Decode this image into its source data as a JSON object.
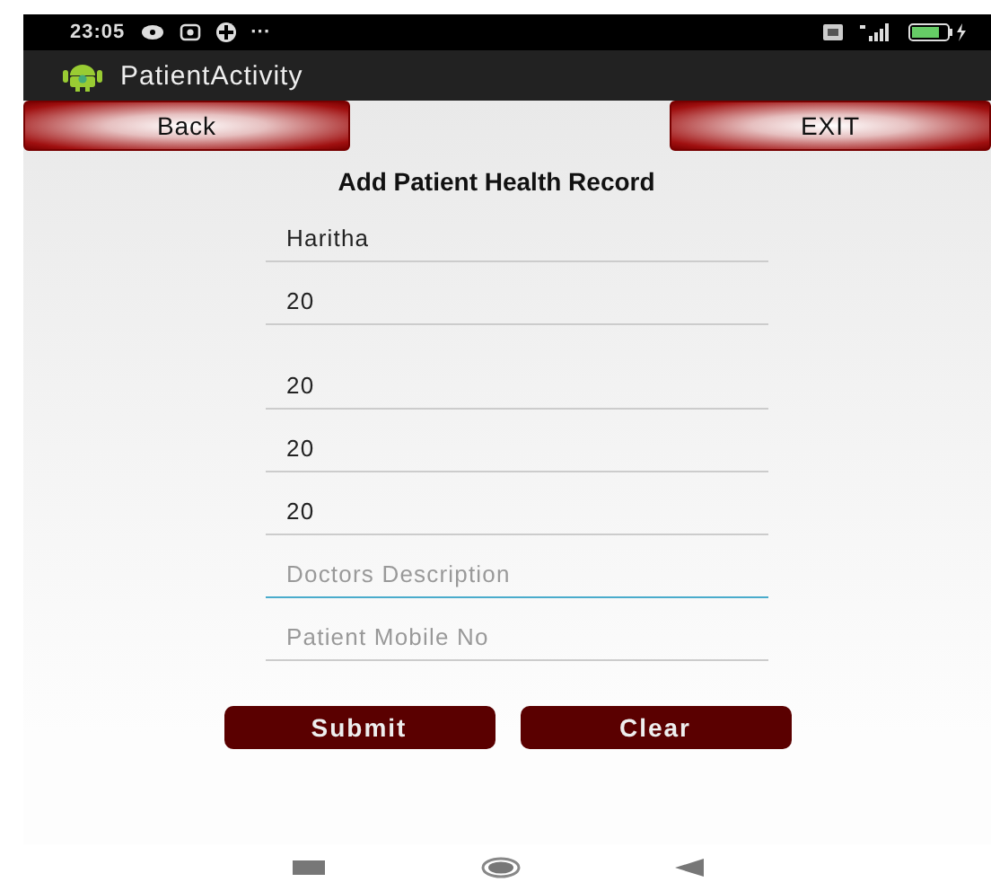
{
  "status_bar": {
    "time": "23:05",
    "more": "···"
  },
  "app_bar": {
    "title": "PatientActivity"
  },
  "top_buttons": [
    "Back",
    "EXIT"
  ],
  "form": {
    "title": "Add Patient Health Record",
    "fields": [
      {
        "value": "Haritha",
        "focused": false
      },
      {
        "value": "20",
        "focused": false
      },
      {
        "value": "20",
        "focused": false
      },
      {
        "value": "20",
        "focused": false
      },
      {
        "value": "20",
        "focused": false
      },
      {
        "placeholder": "Doctors Description",
        "focused": true
      },
      {
        "placeholder": "Patient Mobile No",
        "focused": false
      }
    ],
    "buttons": [
      "Submit",
      "Clear"
    ]
  }
}
